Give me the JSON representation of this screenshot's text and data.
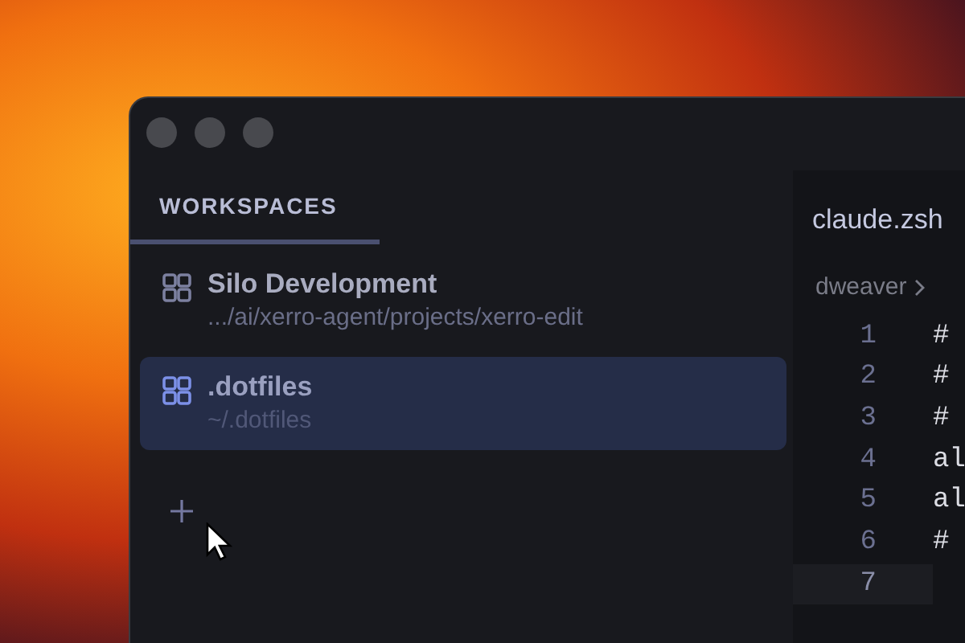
{
  "sidebar": {
    "tab": {
      "label": "WORKSPACES",
      "selected": true
    },
    "workspaces": [
      {
        "name": "Silo Development",
        "path": ".../ai/xerro-agent/projects/xerro-edit",
        "selected": false
      },
      {
        "name": ".dotfiles",
        "path": "~/.dotfiles",
        "selected": true
      }
    ]
  },
  "editor": {
    "tab": {
      "label": "claude.zsh"
    },
    "breadcrumb": [
      "dweaver"
    ],
    "lines": [
      {
        "number": "1",
        "text": "#",
        "current": false
      },
      {
        "number": "2",
        "text": "#",
        "current": false
      },
      {
        "number": "3",
        "text": "#",
        "current": false
      },
      {
        "number": "4",
        "text": "al",
        "current": false
      },
      {
        "number": "5",
        "text": "al",
        "current": false
      },
      {
        "number": "6",
        "text": "#",
        "current": false
      },
      {
        "number": "7",
        "current": true
      }
    ]
  }
}
